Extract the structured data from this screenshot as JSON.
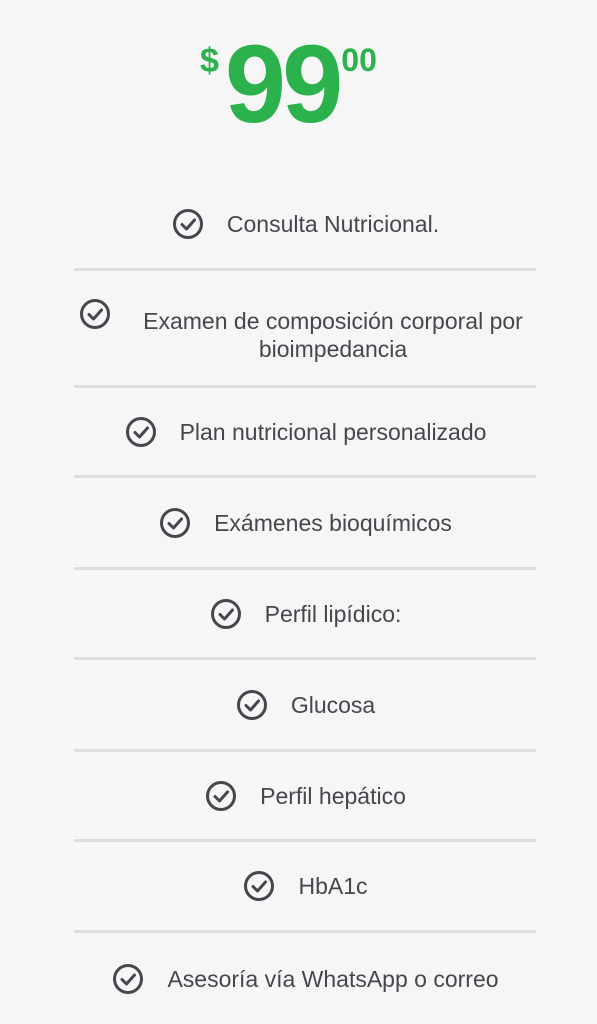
{
  "price": {
    "currency": "$",
    "amount": "99",
    "cents": "00",
    "accent_color": "#2bb24c"
  },
  "features": [
    {
      "icon": "check-circle-icon",
      "label": "Consulta Nutricional."
    },
    {
      "icon": "check-circle-icon",
      "label": "Examen de composición corporal por bioimpedancia"
    },
    {
      "icon": "check-circle-icon",
      "label": "Plan nutricional personalizado"
    },
    {
      "icon": "check-circle-icon",
      "label": "Exámenes bioquímicos"
    },
    {
      "icon": "check-circle-icon",
      "label": "Perfil lipídico:"
    },
    {
      "icon": "check-circle-icon",
      "label": "Glucosa"
    },
    {
      "icon": "check-circle-icon",
      "label": "Perfil hepático"
    },
    {
      "icon": "check-circle-icon",
      "label": "HbA1c"
    },
    {
      "icon": "check-circle-icon",
      "label": "Asesoría vía WhatsApp o correo"
    }
  ]
}
